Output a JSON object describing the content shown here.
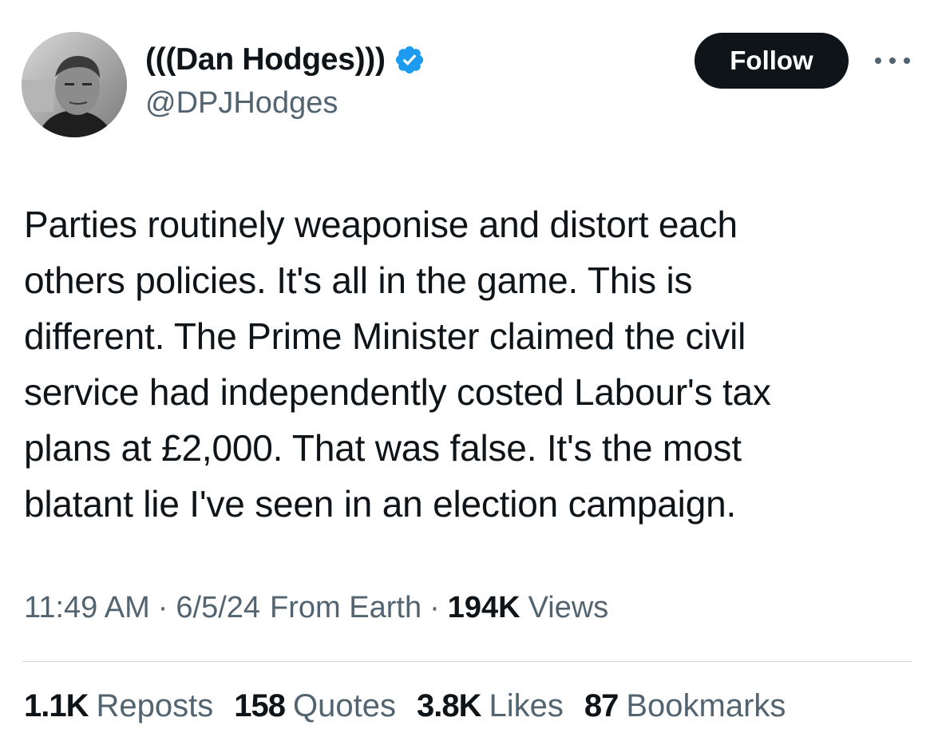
{
  "author": {
    "display_name": "(((Dan Hodges)))",
    "handle": "@DPJHodges",
    "verified": true,
    "verified_color": "#1d9bf0"
  },
  "actions": {
    "follow_label": "Follow"
  },
  "tweet": {
    "lines": [
      "Parties routinely weaponise and distort each",
      "others policies. It's all in the game. This is",
      "different. The Prime Minister claimed the civil",
      "service had independently costed Labour's tax",
      "plans at £2,000. That was false. It's the most",
      "blatant lie I've seen in an election campaign."
    ]
  },
  "meta": {
    "time": "11:49 AM",
    "separator": "·",
    "date": "6/5/24",
    "location": "From Earth",
    "views_count": "194K",
    "views_label": "Views"
  },
  "stats": {
    "reposts_count": "1.1K",
    "reposts_label": "Reposts",
    "quotes_count": "158",
    "quotes_label": "Quotes",
    "likes_count": "3.8K",
    "likes_label": "Likes",
    "bookmarks_count": "87",
    "bookmarks_label": "Bookmarks"
  },
  "icons": {
    "verified": "verified-badge-icon",
    "more": "more-options-icon"
  }
}
